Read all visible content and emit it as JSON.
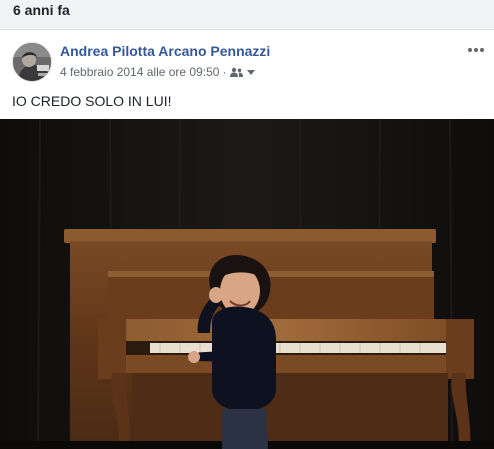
{
  "memory": {
    "title": "6 anni fa"
  },
  "post": {
    "author": "Andrea Pilotta Arcano Pennazzi",
    "timestamp": "4 febbraio 2014 alle ore 09:50",
    "separator": "·",
    "audience_icon": "friends-icon",
    "text": "IO CREDO SOLO IN LUI!",
    "more_icon": "more-options-icon"
  },
  "colors": {
    "author_link": "#365899",
    "meta_text": "#616770",
    "header_bg": "#f2f3f5",
    "body_text": "#1d2129"
  }
}
